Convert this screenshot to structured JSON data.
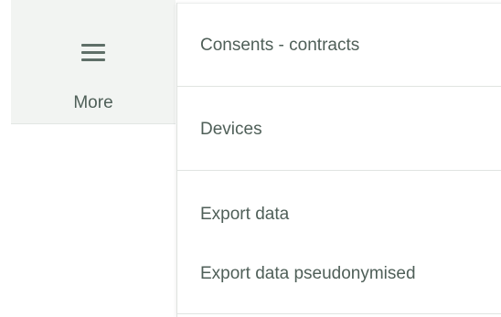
{
  "more_tab": {
    "label": "More",
    "icon": "hamburger-menu-icon"
  },
  "menu": {
    "items": [
      {
        "label": "Consents - contracts"
      },
      {
        "label": "Devices"
      },
      {
        "label": "Export data"
      },
      {
        "label": "Export data pseudonymised"
      }
    ]
  },
  "colors": {
    "text": "#4f5f58",
    "tab_background": "#f2f4f2",
    "divider": "#e0e4e1"
  }
}
